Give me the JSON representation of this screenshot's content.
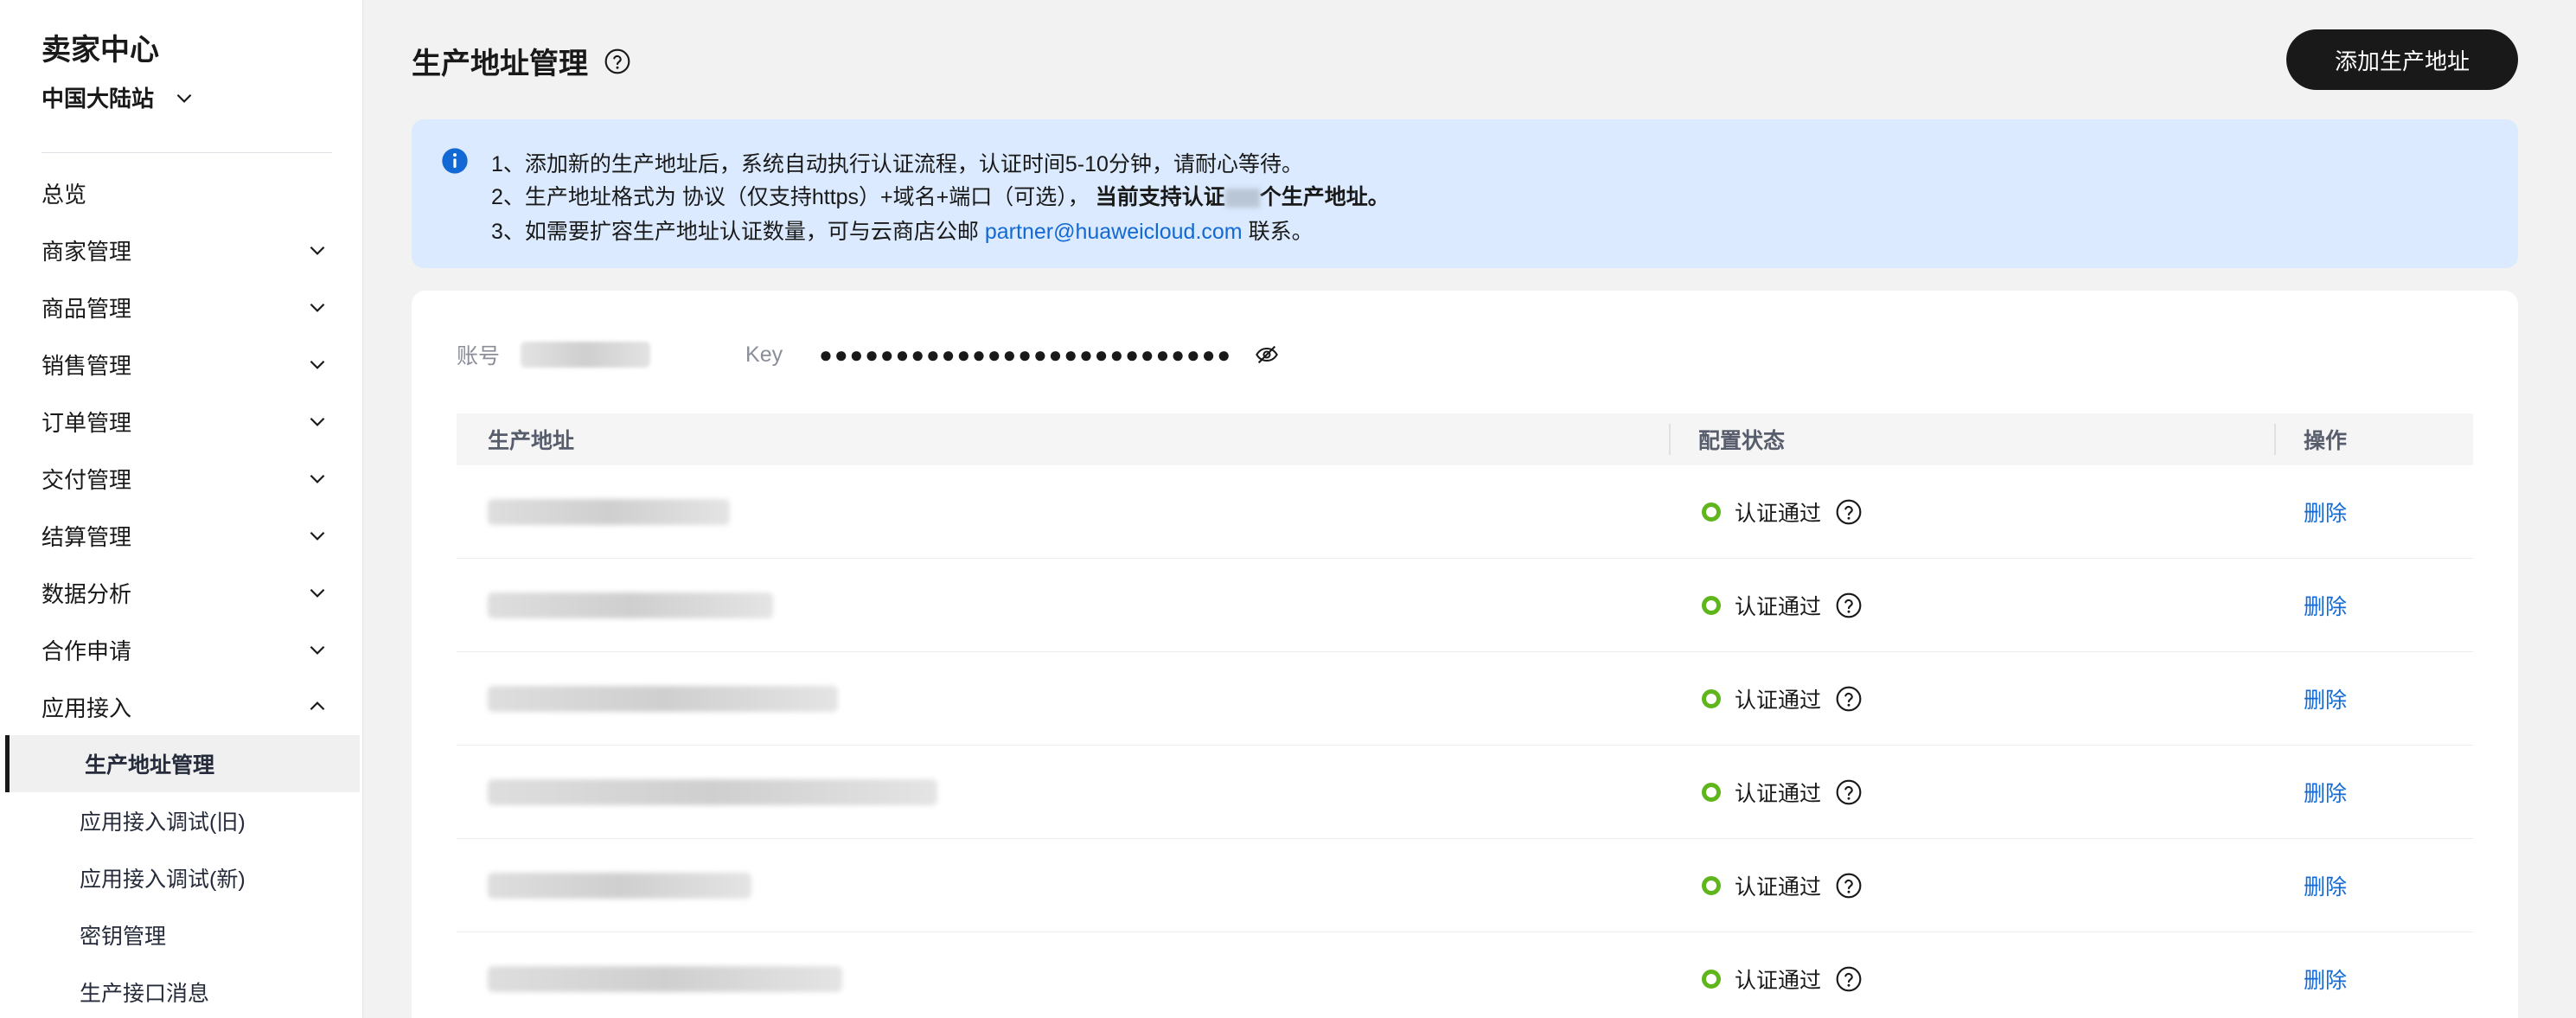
{
  "sidebar": {
    "brand": "卖家中心",
    "region": "中国大陆站",
    "menu": [
      {
        "label": "总览",
        "expandable": false
      },
      {
        "label": "商家管理",
        "expandable": true
      },
      {
        "label": "商品管理",
        "expandable": true
      },
      {
        "label": "销售管理",
        "expandable": true
      },
      {
        "label": "订单管理",
        "expandable": true
      },
      {
        "label": "交付管理",
        "expandable": true
      },
      {
        "label": "结算管理",
        "expandable": true
      },
      {
        "label": "数据分析",
        "expandable": true
      },
      {
        "label": "合作申请",
        "expandable": true
      },
      {
        "label": "应用接入",
        "expandable": true,
        "expanded": true
      }
    ],
    "submenu": [
      {
        "label": "生产地址管理",
        "active": true
      },
      {
        "label": "应用接入调试(旧)"
      },
      {
        "label": "应用接入调试(新)"
      },
      {
        "label": "密钥管理"
      },
      {
        "label": "生产接口消息"
      }
    ]
  },
  "header": {
    "title": "生产地址管理",
    "add_button": "添加生产地址"
  },
  "notice": {
    "line1": "1、添加新的生产地址后，系统自动执行认证流程，认证时间5-10分钟，请耐心等待。",
    "line2_prefix": "2、生产地址格式为 协议（仅支持https）+域名+端口（可选），",
    "line2_bold": "当前支持认证",
    "line2_bold_tail": "个生产地址。",
    "line3_prefix": "3、如需要扩容生产地址认证数量，可与云商店公邮 ",
    "line3_email": "partner@huaweicloud.com",
    "line3_suffix": " 联系。"
  },
  "account": {
    "account_label": "账号",
    "key_label": "Key",
    "key_value": "●●●●●●●●●●●●●●●●●●●●●●●●●●●"
  },
  "table": {
    "columns": [
      "生产地址",
      "配置状态",
      "操作"
    ],
    "rows": [
      {
        "status": "认证通过",
        "action": "删除"
      },
      {
        "status": "认证通过",
        "action": "删除"
      },
      {
        "status": "认证通过",
        "action": "删除"
      },
      {
        "status": "认证通过",
        "action": "删除"
      },
      {
        "status": "认证通过",
        "action": "删除"
      },
      {
        "status": "认证通过",
        "action": "删除"
      }
    ]
  },
  "colors": {
    "primary_dark": "#191919",
    "link": "#1269d3",
    "status_ok": "#5fb51c",
    "notice_bg": "#dbeafe"
  }
}
